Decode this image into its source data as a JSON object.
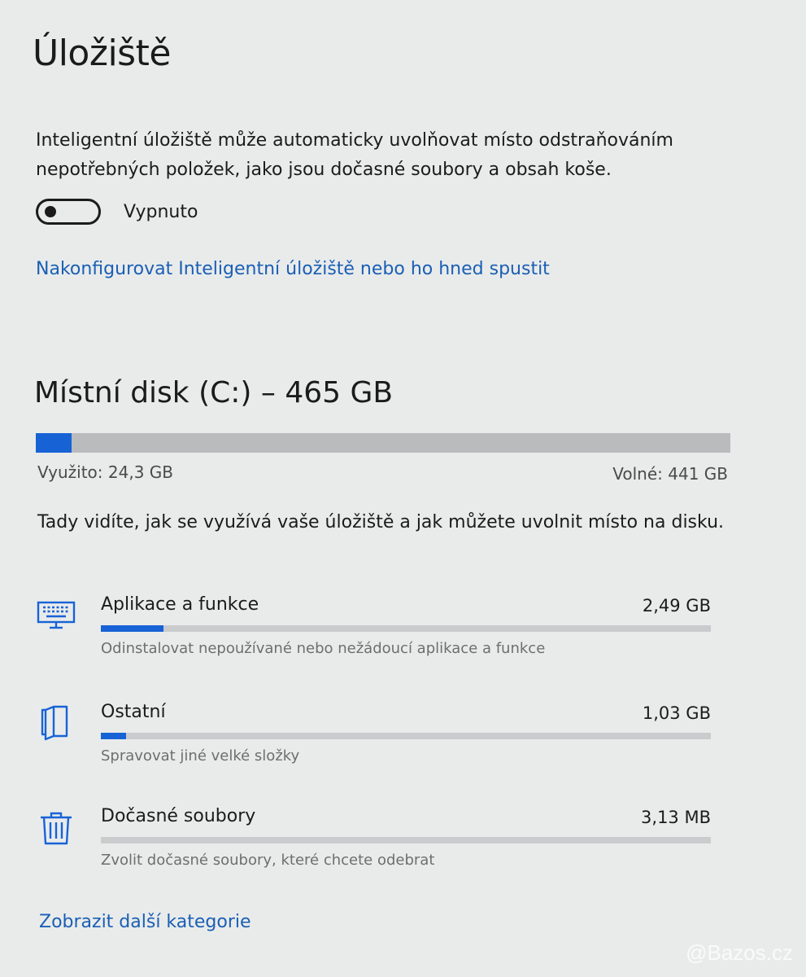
{
  "page": {
    "title": "Úložiště",
    "description": "Inteligentní úložiště může automaticky uvolňovat místo odstraňováním nepotřebných položek, jako jsou dočasné soubory a obsah koše.",
    "toggle_state_label": "Vypnuto",
    "toggle_on": false,
    "config_link": "Nakonfigurovat Inteligentní úložiště nebo ho hned spustit"
  },
  "disk": {
    "title": "Místní disk (C:) – 465 GB",
    "used_label": "Využito: 24,3 GB",
    "free_label": "Volné: 441 GB",
    "used_fraction": 0.052
  },
  "info_text": "Tady vidíte, jak se využívá vaše úložiště a jak můžete uvolnit místo na disku.",
  "categories": [
    {
      "name": "Aplikace a funkce",
      "size": "2,49 GB",
      "subtitle": "Odinstalovat nepoužívané nebo nežádoucí aplikace a funkce",
      "icon": "apps-keyboard-icon",
      "fraction": 0.103
    },
    {
      "name": "Ostatní",
      "size": "1,03 GB",
      "subtitle": "Spravovat jiné velké složky",
      "icon": "folder-icon",
      "fraction": 0.042
    },
    {
      "name": "Dočasné soubory",
      "size": "3,13 MB",
      "subtitle": "Zvolit dočasné soubory, které chcete odebrat",
      "icon": "trash-icon",
      "fraction": 0.0
    }
  ],
  "more_link": "Zobrazit další kategorie",
  "watermark": "Bazos.cz",
  "colors": {
    "accent": "#1763d6",
    "link": "#1a5fb4",
    "bar_track": "#b9bbbd"
  }
}
